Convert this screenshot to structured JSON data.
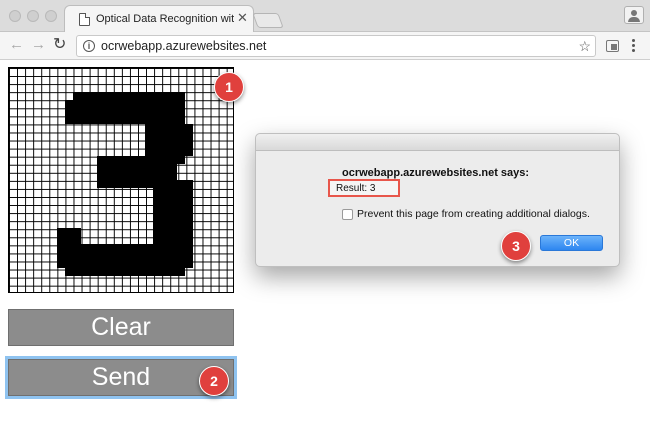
{
  "browser": {
    "tab_title": "Optical Data Recognition with",
    "tab_close": "✕",
    "url": "ocrwebapp.azurewebsites.net",
    "back_icon": "←",
    "forward_icon": "→",
    "reload_icon": "↻",
    "info_icon": "i",
    "bookmark_icon": "☆"
  },
  "page": {
    "drawn_digit": "3",
    "clear_label": "Clear",
    "send_label": "Send"
  },
  "dialog": {
    "title": "ocrwebapp.azurewebsites.net says:",
    "result": "Result: 3",
    "prevent_label": "Prevent this page from creating additional dialogs.",
    "ok_label": "OK"
  },
  "callouts": {
    "one": "1",
    "two": "2",
    "three": "3"
  },
  "colors": {
    "callout": "#e0403d",
    "highlight": "#e8564b",
    "ok_button": "#2e86f0",
    "button_gray": "#8c8c8c"
  }
}
